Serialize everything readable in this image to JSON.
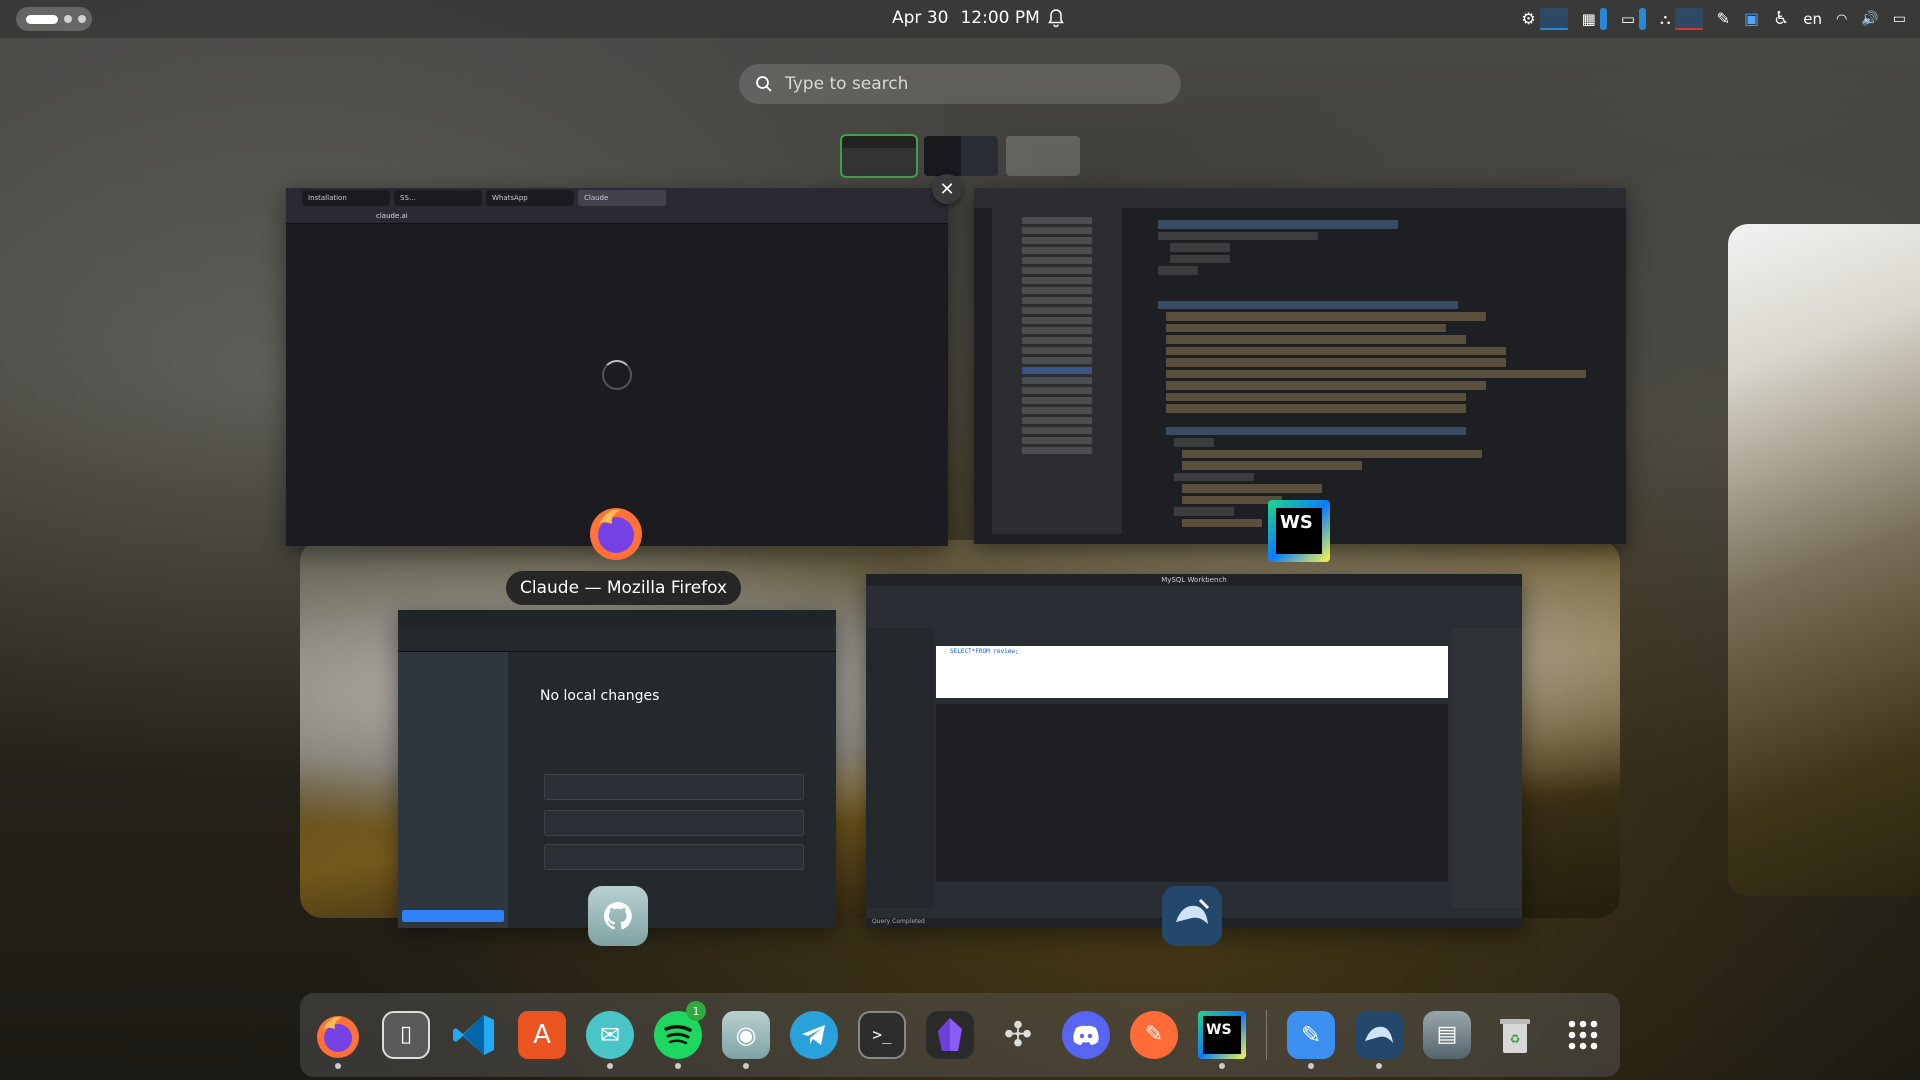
{
  "topbar": {
    "date": "Apr 30",
    "time": "12:00 PM",
    "language": "en"
  },
  "search": {
    "placeholder": "Type to search"
  },
  "overview": {
    "tooltip": "Claude — Mozilla Firefox",
    "firefox_window": {
      "tabs": [
        "Installation",
        "SS...",
        "WhatsApp",
        "Claude"
      ],
      "url": "claude.ai"
    },
    "github_window": {
      "title": "No local changes"
    },
    "mysql_window": {
      "title": "MySQL Workbench",
      "query": "SELECT*FROM review;",
      "status": "Query Completed"
    }
  },
  "dock": {
    "items": [
      {
        "name": "Firefox",
        "running": true
      },
      {
        "name": "Files",
        "running": false
      },
      {
        "name": "Visual Studio Code",
        "running": false
      },
      {
        "name": "App Center",
        "running": false
      },
      {
        "name": "Mail",
        "running": true
      },
      {
        "name": "Spotify",
        "running": true,
        "badge": "1"
      },
      {
        "name": "GitHub Desktop",
        "running": true
      },
      {
        "name": "Telegram",
        "running": false
      },
      {
        "name": "Terminal",
        "running": false
      },
      {
        "name": "Obsidian",
        "running": false
      },
      {
        "name": "Blender",
        "running": false
      },
      {
        "name": "Discord",
        "running": false
      },
      {
        "name": "Postman",
        "running": false
      },
      {
        "name": "WebStorm",
        "running": true
      },
      {
        "name": "Text Editor",
        "running": true
      },
      {
        "name": "MySQL Workbench",
        "running": true
      },
      {
        "name": "Disks",
        "running": false
      },
      {
        "name": "Trash",
        "running": false
      },
      {
        "name": "Show Apps",
        "running": false
      }
    ]
  }
}
